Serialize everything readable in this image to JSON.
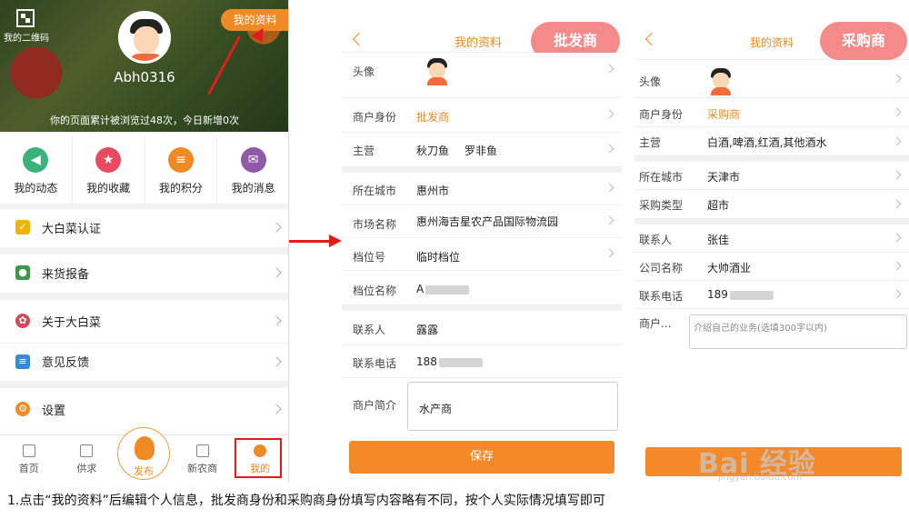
{
  "panel1": {
    "qr_label": "我的二维码",
    "profile_button": "我的资料",
    "username": "Abh0316",
    "visits_text": "你的页面累计被浏览过48次，今日新增0次",
    "quick_items": [
      {
        "label": "我的动态",
        "icon": "megaphone-icon",
        "color": "#3ab27a"
      },
      {
        "label": "我的收藏",
        "icon": "star-icon",
        "color": "#e84a5f"
      },
      {
        "label": "我的积分",
        "icon": "coins-icon",
        "color": "#f08a24"
      },
      {
        "label": "我的消息",
        "icon": "mail-icon",
        "color": "#8e5aa8"
      }
    ],
    "menu": [
      {
        "label": "大白菜认证",
        "icon": "shield-icon",
        "color": "#f0b400"
      },
      {
        "label": "来货报备",
        "icon": "user-icon",
        "color": "#3a9a4a"
      },
      {
        "label": "关于大白菜",
        "icon": "cabbage-icon",
        "color": "#d04a5a"
      },
      {
        "label": "意见反馈",
        "icon": "chat-icon",
        "color": "#3a8ad0"
      },
      {
        "label": "设置",
        "icon": "gear-icon",
        "color": "#f08a24"
      }
    ],
    "tabs": [
      "首页",
      "供求",
      "发布",
      "新农商",
      "我的"
    ]
  },
  "panel2": {
    "title": "我的资料",
    "badge": "批发商",
    "rows": {
      "avatar": "头像",
      "identity_label": "商户身份",
      "identity_value": "批发商",
      "business_label": "主营",
      "business_value_1": "秋刀鱼",
      "business_value_2": "罗非鱼",
      "city_label": "所在城市",
      "city_value": "惠州市",
      "market_label": "市场名称",
      "market_value": "惠州海吉星农产品国际物流园",
      "stall_label": "档位号",
      "stall_value": "临时档位",
      "stallname_label": "档位名称",
      "stallname_value": "A",
      "contact_label": "联系人",
      "contact_value": "露露",
      "phone_label": "联系电话",
      "phone_value": "188",
      "intro_label": "商户简介",
      "intro_value": "水产商"
    },
    "save": "保存"
  },
  "panel3": {
    "title": "我的资料",
    "badge": "采购商",
    "rows": {
      "avatar": "头像",
      "identity_label": "商户身份",
      "identity_value": "采购商",
      "business_label": "主营",
      "business_value": "白酒,啤酒,红酒,其他酒水",
      "city_label": "所在城市",
      "city_value": "天津市",
      "type_label": "采购类型",
      "type_value": "超市",
      "contact_label": "联系人",
      "contact_value": "张佳",
      "company_label": "公司名称",
      "company_value": "大帅酒业",
      "phone_label": "联系电话",
      "phone_value": "189",
      "intro_label": "商户...",
      "intro_placeholder": "介绍自己的业务(选填300字以内)"
    }
  },
  "caption": "1.点击“我的资料”后编辑个人信息，批发商身份和采购商身份填写内容略有不同，按个人实际情况填写即可",
  "watermark": "Bai 经验",
  "watermark_sub": "jingyan.baidu.com",
  "colors": {
    "accent": "#f08a24",
    "badge": "#f48a8a",
    "highlight": "#e21b1b"
  }
}
